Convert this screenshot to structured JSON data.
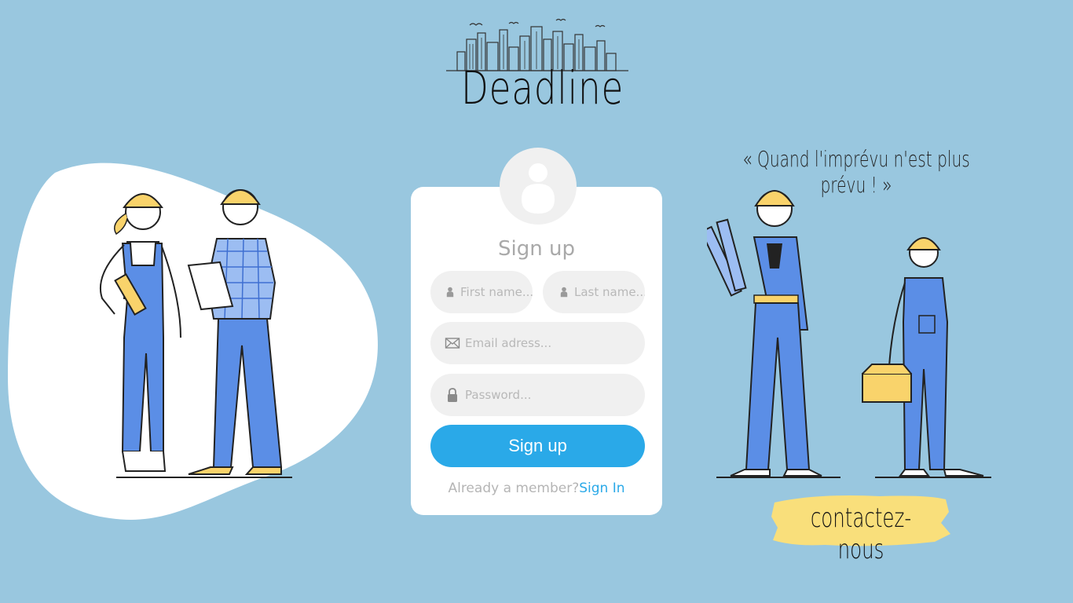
{
  "brand": {
    "name": "Deadline"
  },
  "tagline": "« Quand l'imprévu n'est plus prévu ! »",
  "form": {
    "title": "Sign up",
    "first_name_placeholder": "First name...",
    "last_name_placeholder": "Last name...",
    "email_placeholder": "Email adress...",
    "password_placeholder": "Password...",
    "submit_label": "Sign up",
    "member_text": "Already a member?",
    "signin_label": "Sign In"
  },
  "contact": {
    "label": "contactez-nous"
  },
  "colors": {
    "background": "#99c7df",
    "accent": "#2aa9e8",
    "highlight": "#f9df7b",
    "worker_blue": "#5b8ee6"
  },
  "icons": [
    "skyline-icon",
    "user-icon",
    "envelope-icon",
    "lock-icon",
    "avatar-icon"
  ]
}
